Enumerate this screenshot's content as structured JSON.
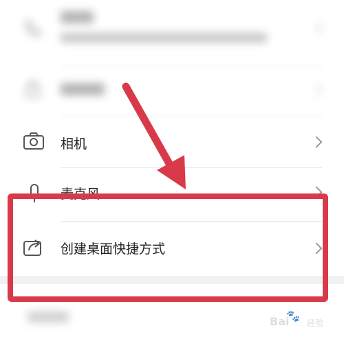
{
  "settings_list": {
    "items": [
      {
        "label": "",
        "icon": "phone-icon",
        "blurred": true
      },
      {
        "label": "",
        "icon": "lock-icon",
        "blurred": true
      },
      {
        "label": "相机",
        "icon": "camera-icon",
        "blurred": false
      },
      {
        "label": "麦克风",
        "icon": "microphone-icon",
        "blurred": false
      },
      {
        "label": "创建桌面快捷方式",
        "icon": "shortcut-icon",
        "blurred": false
      }
    ]
  },
  "annotation": {
    "arrow_color": "#d83a4a",
    "box_color": "#d83a4a"
  },
  "watermark": {
    "brand": "Bai",
    "suffix": "经验"
  }
}
